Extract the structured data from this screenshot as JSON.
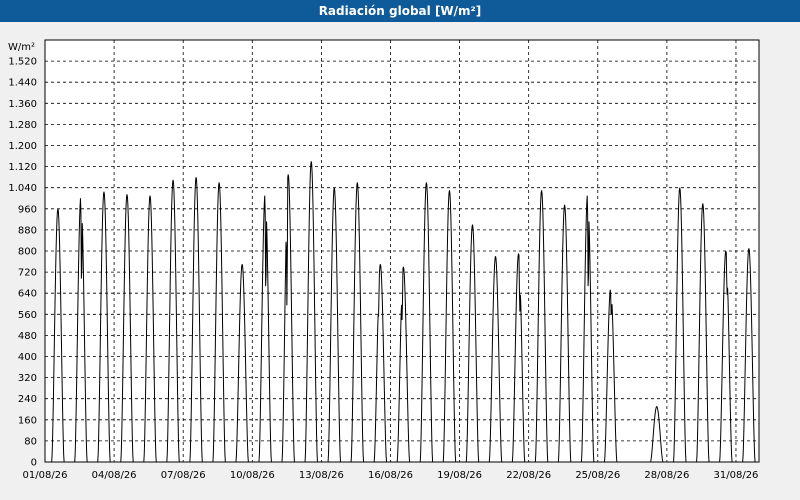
{
  "window": {
    "title": "Radiación global [W/m²]"
  },
  "colors": {
    "titlebar": "#0f5a99",
    "background": "#f0f0f0",
    "plot": "#ffffff",
    "line": "#000000",
    "grid": "#000000"
  },
  "chart_data": {
    "type": "line",
    "title": "Radiación global [W/m²]",
    "ylabel": "W/m²",
    "xlabel": "",
    "ylim": [
      0,
      1600
    ],
    "y_ticks": [
      "0",
      "80",
      "160",
      "240",
      "320",
      "400",
      "480",
      "560",
      "640",
      "720",
      "800",
      "880",
      "960",
      "1.040",
      "1.120",
      "1.200",
      "1.280",
      "1.360",
      "1.440",
      "1.520"
    ],
    "y_tick_values": [
      0,
      80,
      160,
      240,
      320,
      400,
      480,
      560,
      640,
      720,
      800,
      880,
      960,
      1040,
      1120,
      1200,
      1280,
      1360,
      1440,
      1520
    ],
    "x_ticks": [
      "01/08/26",
      "04/08/26",
      "07/08/26",
      "10/08/26",
      "13/08/26",
      "16/08/26",
      "19/08/26",
      "22/08/26",
      "25/08/26",
      "28/08/26",
      "31/08/26"
    ],
    "x_range_days": [
      0,
      31
    ],
    "grid": true,
    "grid_style": "dashed",
    "series": [
      {
        "day_start": [
          "01/08/26",
          "02/08/26",
          "03/08/26",
          "04/08/26",
          "05/08/26",
          "06/08/26",
          "07/08/26",
          "08/08/26",
          "09/08/26",
          "10/08/26",
          "11/08/26",
          "12/08/26",
          "13/08/26",
          "14/08/26",
          "15/08/26",
          "16/08/26",
          "17/08/26",
          "18/08/26",
          "19/08/26",
          "20/08/26",
          "21/08/26",
          "22/08/26",
          "23/08/26",
          "24/08/26",
          "25/08/26",
          "26/08/26",
          "27/08/26",
          "28/08/26",
          "29/08/26",
          "30/08/26",
          "31/08/26"
        ],
        "daily_peak": [
          960,
          1010,
          1025,
          1015,
          1010,
          1070,
          1080,
          1060,
          750,
          1020,
          1090,
          1140,
          1040,
          1060,
          750,
          740,
          1060,
          1030,
          900,
          780,
          790,
          1030,
          975,
          1020,
          660,
          null,
          210,
          1040,
          980,
          800,
          810
        ],
        "dips": [
          {
            "day": 1,
            "frac": 0.55,
            "value": 600
          },
          {
            "day": 9,
            "frac": 0.55,
            "value": 560
          },
          {
            "day": 10,
            "frac": 0.4,
            "value": 540
          },
          {
            "day": 14,
            "frac": 0.35,
            "value": 540
          },
          {
            "day": 15,
            "frac": 0.4,
            "value": 520
          },
          {
            "day": 20,
            "frac": 0.6,
            "value": 550
          },
          {
            "day": 23,
            "frac": 0.55,
            "value": 560
          },
          {
            "day": 24,
            "frac": 0.55,
            "value": 530
          },
          {
            "day": 29,
            "frac": 0.6,
            "value": 620
          }
        ]
      }
    ]
  }
}
